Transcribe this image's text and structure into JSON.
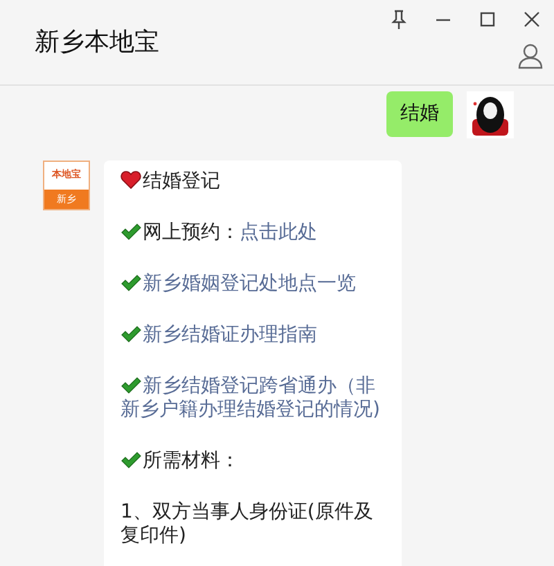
{
  "window": {
    "title": "新乡本地宝"
  },
  "messages": [
    {
      "kind": "outgoing",
      "text": "结婚"
    },
    {
      "kind": "incoming",
      "avatar": {
        "brand": "本地宝",
        "city": "新乡"
      },
      "lines": [
        {
          "kind": "heading",
          "label": "结婚登记"
        },
        {
          "kind": "check",
          "label": "网上预约：",
          "link": "点击此处"
        },
        {
          "kind": "check",
          "link": "新乡婚姻登记处地点一览"
        },
        {
          "kind": "check",
          "link": "新乡结婚证办理指南"
        },
        {
          "kind": "check",
          "link": "新乡结婚登记跨省通办（非新乡户籍办理结婚登记的情况)"
        },
        {
          "kind": "check",
          "label": "所需材料："
        },
        {
          "kind": "plain",
          "label": "1、双方当事人身份证(原件及复印件)"
        }
      ]
    }
  ]
}
